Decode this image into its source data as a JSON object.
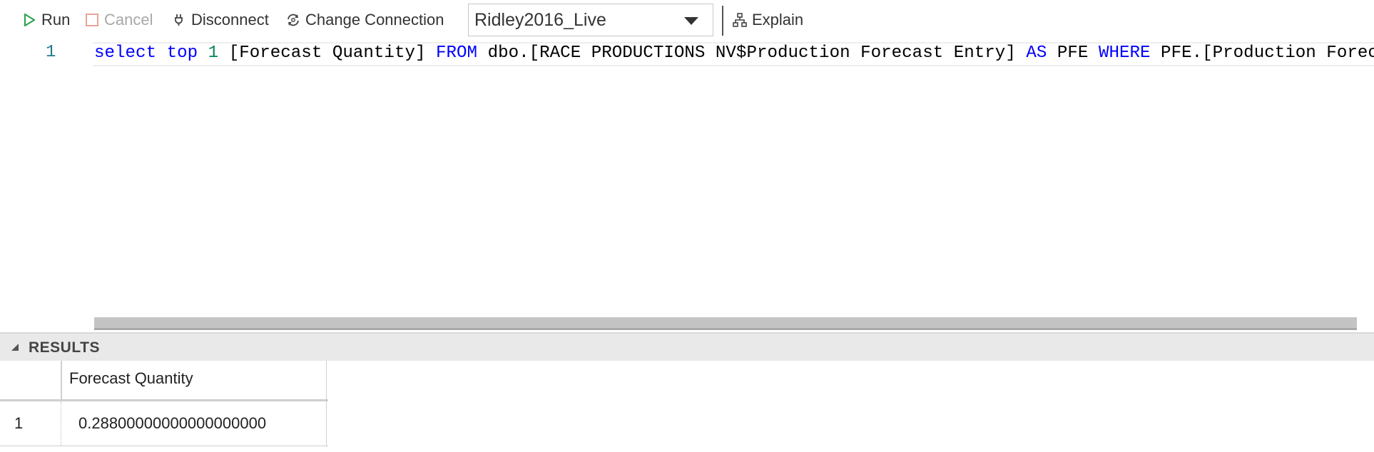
{
  "toolbar": {
    "run_label": "Run",
    "cancel_label": "Cancel",
    "disconnect_label": "Disconnect",
    "change_connection_label": "Change Connection",
    "database": "Ridley2016_Live",
    "explain_label": "Explain",
    "colors": {
      "run_icon": "#2da44e",
      "cancel_icon": "#e8a398"
    }
  },
  "editor": {
    "line_number": "1",
    "tokens": [
      {
        "text": "select",
        "type": "kw"
      },
      {
        "text": " ",
        "type": "id"
      },
      {
        "text": "top",
        "type": "kw"
      },
      {
        "text": " ",
        "type": "id"
      },
      {
        "text": "1",
        "type": "num"
      },
      {
        "text": " [Forecast Quantity] ",
        "type": "id"
      },
      {
        "text": "FROM",
        "type": "kw"
      },
      {
        "text": " dbo.[RACE PRODUCTIONS NV$Production Forecast Entry] ",
        "type": "id"
      },
      {
        "text": "AS",
        "type": "kw"
      },
      {
        "text": " PFE ",
        "type": "id"
      },
      {
        "text": "WHERE",
        "type": "kw"
      },
      {
        "text": " PFE.[Production Foreca",
        "type": "id"
      }
    ]
  },
  "results": {
    "title": "RESULTS",
    "columns": [
      "Forecast Quantity"
    ],
    "rows": [
      {
        "row_number": "1",
        "values": [
          "0.28800000000000000000"
        ]
      }
    ]
  }
}
